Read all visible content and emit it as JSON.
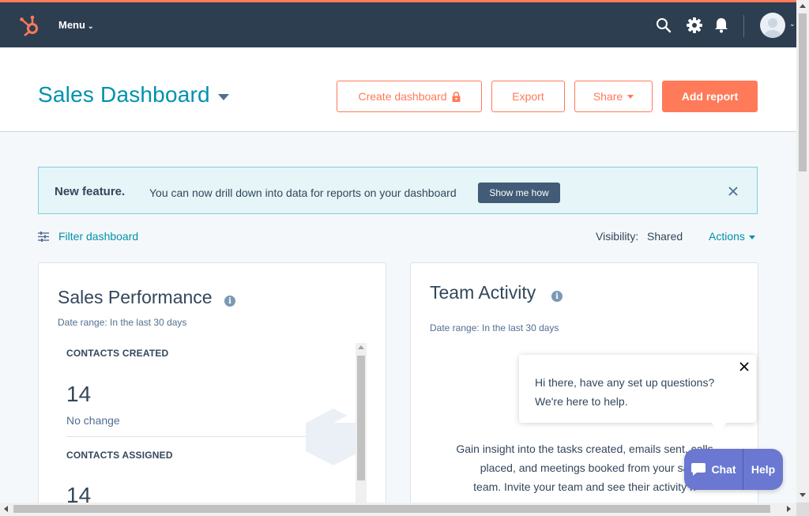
{
  "topbar": {
    "menu_label": "Menu",
    "accent": "#ff7a59",
    "bg": "#2d3e50",
    "icons": [
      "sprocket-logo-icon",
      "search-icon",
      "gear-icon",
      "bell-icon",
      "avatar-icon"
    ]
  },
  "header": {
    "title": "Sales Dashboard",
    "buttons": {
      "create_dashboard": "Create dashboard",
      "export": "Export",
      "share": "Share",
      "add_report": "Add report"
    }
  },
  "banner": {
    "title": "New feature.",
    "text": "You can now drill down into data for reports on your dashboard",
    "button": "Show me how"
  },
  "filter": {
    "label": "Filter dashboard",
    "visibility_label": "Visibility:",
    "visibility_value": "Shared",
    "actions_label": "Actions"
  },
  "cards": {
    "sales": {
      "title": "Sales Performance",
      "date_range": "Date range:  In the last 30 days",
      "metrics": [
        {
          "label": "CONTACTS CREATED",
          "value": "14",
          "change": "No change"
        },
        {
          "label": "CONTACTS ASSIGNED",
          "value": "14"
        }
      ]
    },
    "activity": {
      "title": "Team Activity",
      "date_range": "Date range:  In the last 30 days",
      "line1": "Gain insight into the tasks created, emails sent, calls",
      "line2": "placed, and meetings booked from your sa",
      "line3": "team. Invite your team and see their activity h"
    }
  },
  "popup": {
    "line1": "Hi there, have any set up questions?",
    "line2": "We're here to help."
  },
  "chat": {
    "chat_label": "Chat",
    "help_label": "Help",
    "color": "#6a78d1"
  }
}
